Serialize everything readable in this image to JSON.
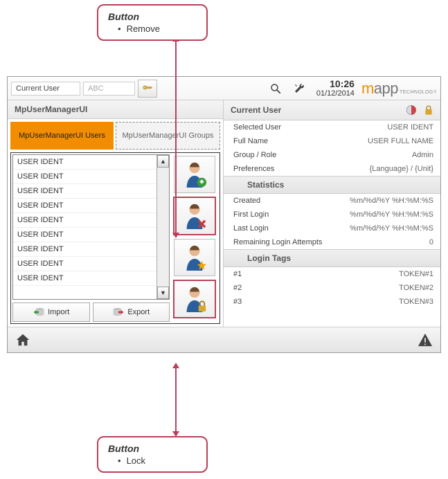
{
  "annotations": {
    "top": {
      "title": "Button",
      "item": "Remove"
    },
    "bottom": {
      "title": "Button",
      "item": "Lock"
    }
  },
  "header": {
    "current_user_label": "Current User",
    "abc": "ABC",
    "time": "10:26",
    "date": "01/12/2014",
    "logo_m": "m",
    "logo_rest": "app",
    "logo_sub": "TECHNOLOGY"
  },
  "panel_title": "MpUserManagerUI",
  "tabs": {
    "users": "MpUserManagerUI Users",
    "groups": "MpUserManagerUI Groups"
  },
  "user_list": [
    "USER IDENT",
    "USER IDENT",
    "USER IDENT",
    "USER IDENT",
    "USER IDENT",
    "USER IDENT",
    "USER IDENT",
    "USER IDENT",
    "USER IDENT"
  ],
  "buttons": {
    "import": "Import",
    "export": "Export"
  },
  "right": {
    "title": "Current User",
    "selected_user_k": "Selected User",
    "selected_user_v": "USER IDENT",
    "fullname_k": "Full Name",
    "fullname_v": "USER FULL NAME",
    "group_k": "Group / Role",
    "group_v": "Admin",
    "prefs_k": "Preferences",
    "prefs_v": "{Language} / {Unit}",
    "stats_title": "Statistics",
    "created_k": "Created",
    "created_v": "%m/%d/%Y %H:%M:%S",
    "firstlogin_k": "First Login",
    "firstlogin_v": "%m/%d/%Y %H:%M:%S",
    "lastlogin_k": "Last Login",
    "lastlogin_v": "%m/%d/%Y %H:%M:%S",
    "remaining_k": "Remaining Login Attempts",
    "remaining_v": "0",
    "tags_title": "Login Tags",
    "tag1_k": "#1",
    "tag1_v": "TOKEN#1",
    "tag2_k": "#2",
    "tag2_v": "TOKEN#2",
    "tag3_k": "#3",
    "tag3_v": "TOKEN#3"
  }
}
